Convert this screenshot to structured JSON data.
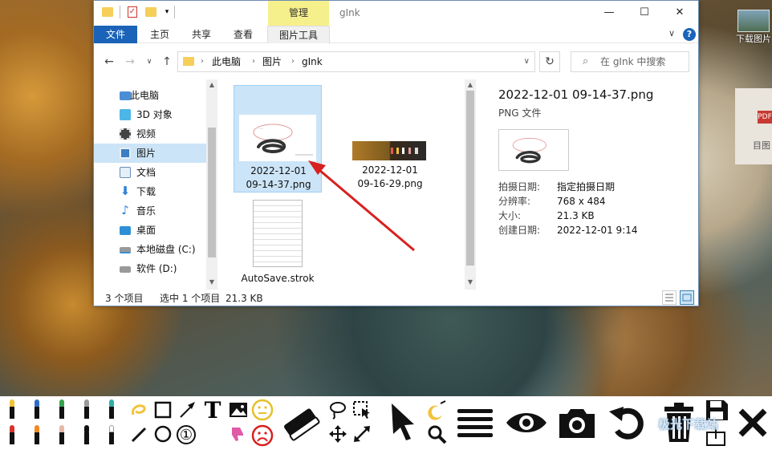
{
  "desktop": {
    "icon_label": "下载图片",
    "side_badge": "PDF",
    "side_text": "目图"
  },
  "window": {
    "manage_tab": "管理",
    "title": "gInk",
    "controls": {
      "minimize": "—",
      "maximize": "☐",
      "close": "✕"
    },
    "ribbon": {
      "tabs": [
        "文件",
        "主页",
        "共享",
        "查看",
        "图片工具"
      ],
      "expand": "∨",
      "help": "?"
    },
    "address": {
      "back": "←",
      "forward": "→",
      "dropdown": "∨",
      "up": "↑",
      "crumbs": [
        "此电脑",
        "图片",
        "gInk"
      ],
      "separator": "›",
      "refresh": "↻",
      "search_placeholder": "在 gInk 中搜索"
    },
    "nav_items": [
      {
        "label": "此电脑",
        "icon": "computer-icon",
        "color": "#4a8fd6"
      },
      {
        "label": "3D 对象",
        "icon": "cube-icon",
        "color": "#4cb6e8"
      },
      {
        "label": "视频",
        "icon": "film-icon",
        "color": "#444444"
      },
      {
        "label": "图片",
        "icon": "picture-icon",
        "color": "#3b7fc4",
        "selected": true
      },
      {
        "label": "文档",
        "icon": "document-icon",
        "color": "#6b8fb5"
      },
      {
        "label": "下载",
        "icon": "download-icon",
        "color": "#2f7fd6"
      },
      {
        "label": "音乐",
        "icon": "music-icon",
        "color": "#2f7fd6"
      },
      {
        "label": "桌面",
        "icon": "desktop-icon",
        "color": "#2f8fd6"
      },
      {
        "label": "本地磁盘 (C:)",
        "icon": "drive-icon",
        "color": "#777777"
      },
      {
        "label": "软件 (D:)",
        "icon": "drive-icon",
        "color": "#777777"
      }
    ],
    "files": [
      {
        "name_line1": "2022-12-01",
        "name_line2": "09-14-37.png",
        "selected": true
      },
      {
        "name_line1": "2022-12-01",
        "name_line2": "09-16-29.png",
        "selected": false
      },
      {
        "name_line1": "AutoSave.strok",
        "name_line2": "",
        "selected": false
      }
    ],
    "preview": {
      "title": "2022-12-01 09-14-37.png",
      "type": "PNG 文件",
      "props": [
        {
          "key": "拍摄日期:",
          "value": "指定拍摄日期"
        },
        {
          "key": "分辨率:",
          "value": "768 x 484"
        },
        {
          "key": "大小:",
          "value": "21.3 KB"
        },
        {
          "key": "创建日期:",
          "value": "2022-12-01 9:14"
        }
      ]
    },
    "status": {
      "count": "3 个项目",
      "selected": "选中 1 个项目",
      "size": "21.3 KB"
    }
  },
  "toolbar": {
    "pens_top": [
      "#f2c23a",
      "#2d6cc4",
      "#36a34a",
      "#9a9a9a",
      "#2fb0a5"
    ],
    "pens_bottom": [
      "#d8322c",
      "#f08a24",
      "#e7b7a5",
      "#111111",
      "#ffffff"
    ],
    "highlight_color": "#f2c23a",
    "number_tool": "①",
    "text_tool": "T",
    "watermark": "极光下载站"
  }
}
